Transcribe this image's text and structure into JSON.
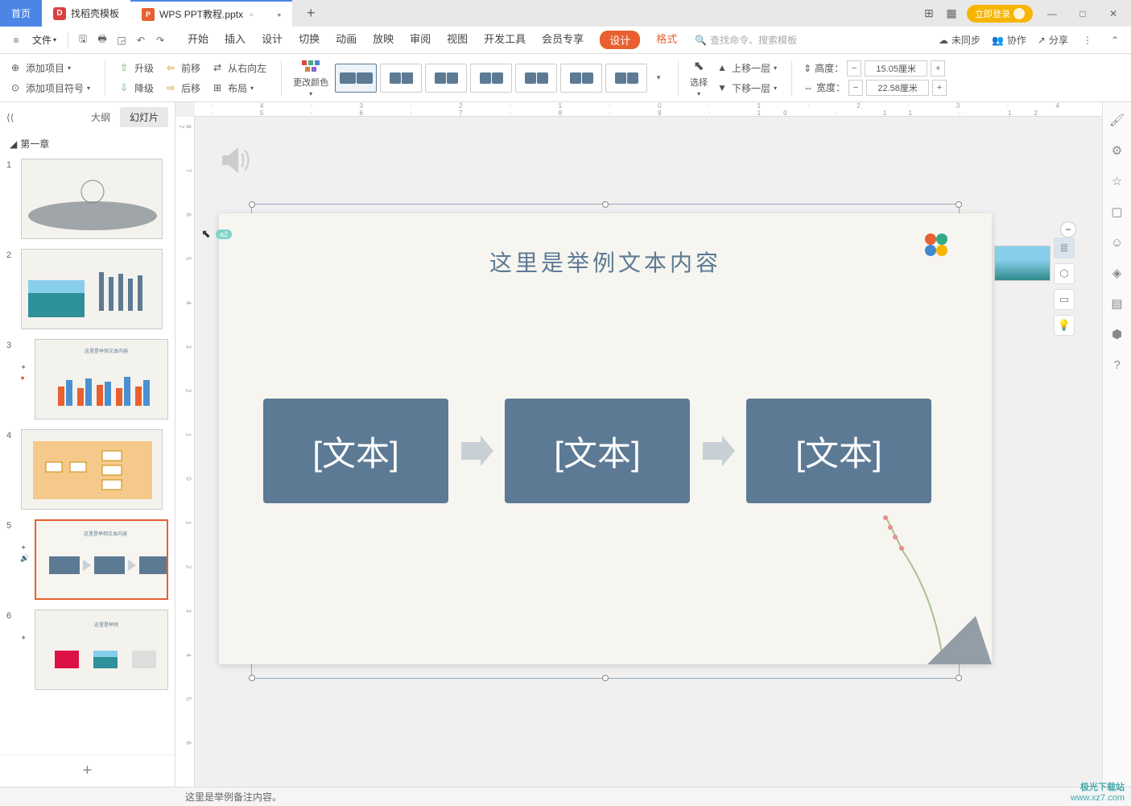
{
  "tabs": {
    "home": "首页",
    "docao": "找稻壳模板",
    "file": "WPS PPT教程.pptx"
  },
  "login": "立即登录",
  "menubar": {
    "file": "文件",
    "tabs": [
      "开始",
      "插入",
      "设计",
      "切换",
      "动画",
      "放映",
      "审阅",
      "视图",
      "开发工具",
      "会员专享"
    ],
    "design": "设计",
    "format": "格式",
    "search_placeholder": "查找命令、搜索模板",
    "unsync": "未同步",
    "collab": "协作",
    "share": "分享"
  },
  "ribbon": {
    "add_item": "添加项目",
    "add_bullet": "添加项目符号",
    "promote": "升级",
    "demote": "降级",
    "move_before": "前移",
    "move_after": "后移",
    "rtl": "从右向左",
    "layout": "布局",
    "change_color": "更改颜色",
    "select": "选择",
    "move_up": "上移一层",
    "move_down": "下移一层",
    "height_label": "高度：",
    "width_label": "宽度：",
    "height_value": "15.05厘米",
    "width_value": "22.58厘米"
  },
  "outline": {
    "outline_tab": "大纲",
    "slides_tab": "幻灯片",
    "section": "第一章"
  },
  "slide": {
    "title": "这里是举例文本内容",
    "box1": "[文本]",
    "box2": "[文本]",
    "box3": "[文本]",
    "marker": "a2"
  },
  "notes": "这里是举例备注内容。",
  "watermark": {
    "name": "极光下载站",
    "url": "www.xz7.com"
  },
  "thumbs": [
    {
      "n": "1"
    },
    {
      "n": "2"
    },
    {
      "n": "3"
    },
    {
      "n": "4"
    },
    {
      "n": "5"
    },
    {
      "n": "6"
    }
  ]
}
